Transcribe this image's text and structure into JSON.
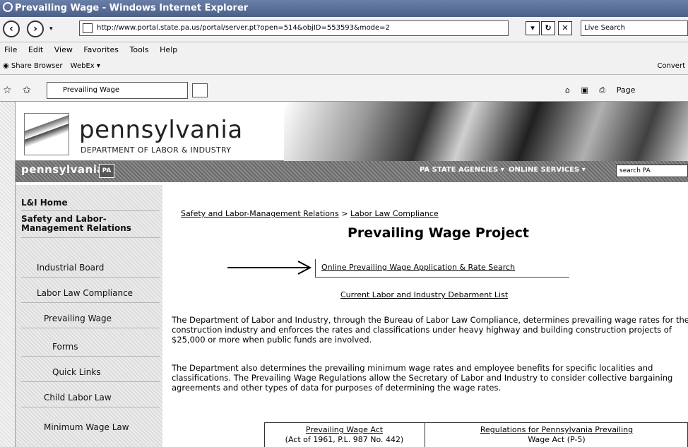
{
  "window": {
    "title": "Prevailing Wage - Windows Internet Explorer"
  },
  "addressbar": {
    "url": "http://www.portal.state.pa.us/portal/server.pt?open=514&objID=553593&mode=2"
  },
  "search": {
    "placeholder": "Live Search"
  },
  "menu": {
    "items": [
      "File",
      "Edit",
      "View",
      "Favorites",
      "Tools",
      "Help"
    ]
  },
  "links": {
    "share": "Share Browser",
    "webex": "WebEx",
    "convert": "Convert"
  },
  "tab": {
    "label": "Prevailing Wage"
  },
  "commandbar": {
    "page": "Page"
  },
  "banner": {
    "state": "pennsylvania",
    "dept": "DEPARTMENT OF LABOR & INDUSTRY"
  },
  "statebar": {
    "brand": "pennsylvania",
    "badge": "PA",
    "agencies": "PA STATE AGENCIES",
    "services": "ONLINE SERVICES",
    "search_placeholder": "search PA"
  },
  "sidebar": {
    "items": [
      "L&I Home",
      "Safety and Labor-Management Relations",
      "Industrial Board",
      "Labor Law Compliance",
      "Prevailing Wage",
      "Forms",
      "Quick Links",
      "Child Labor Law",
      "Minimum Wage Law"
    ]
  },
  "breadcrumb": {
    "parent": "Safety and Labor-Management Relations",
    "sep": ">",
    "current": "Labor Law Compliance"
  },
  "content": {
    "heading": "Prevailing Wage Project",
    "app_link": "Online Prevailing Wage Application & Rate Search",
    "debarment_link": "Current Labor and Industry Debarment List",
    "para1": "The Department of Labor and Industry, through the Bureau of Labor Law Compliance, determines prevailing wage rates for the construction industry and enforces the rates and classifications under heavy highway and building construction projects of $25,000 or more when public funds are involved.",
    "para2": "The Department also determines the prevailing minimum wage rates and employee benefits for specific localities and classifications. The Prevailing Wage Regulations allow the Secretary of Labor and Industry to consider collective bargaining agreements and other types of data for purposes of determining the wage rates.",
    "table": {
      "cell1_line1": "Prevailing Wage Act",
      "cell1_line2": "(Act of 1961, P.L. 987 No. 442)",
      "cell2_line1": "Regulations for Pennsylvania Prevailing",
      "cell2_line2": "Wage Act (P-5)"
    }
  }
}
